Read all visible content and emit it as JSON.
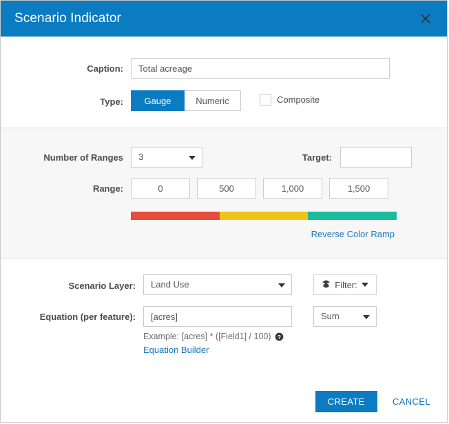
{
  "header": {
    "title": "Scenario Indicator",
    "close_icon": "close-icon"
  },
  "form": {
    "caption": {
      "label": "Caption:",
      "value": "Total acreage"
    },
    "type": {
      "label": "Type:",
      "options": [
        "Gauge",
        "Numeric"
      ],
      "selected": "Gauge",
      "composite_label": "Composite",
      "composite_checked": false
    },
    "ranges": {
      "number_label": "Number of Ranges",
      "number_value": "3",
      "target_label": "Target:",
      "target_value": "",
      "range_label": "Range:",
      "range_values": [
        "0",
        "500",
        "1,000",
        "1,500"
      ],
      "reverse_link": "Reverse Color Ramp",
      "ramp_colors": [
        "#e74c3c",
        "#efc317",
        "#1abc9c"
      ]
    },
    "layer": {
      "label": "Scenario Layer:",
      "value": "Land Use",
      "filter_label": "Filter:",
      "filter_icon": "layers-icon"
    },
    "equation": {
      "label": "Equation (per feature):",
      "value": "[acres]",
      "example": "Example: [acres] * ([Field1] / 100)",
      "help_icon": "help-icon",
      "builder_link": "Equation Builder",
      "aggregation_value": "Sum"
    }
  },
  "footer": {
    "create_label": "CREATE",
    "cancel_label": "CANCEL"
  },
  "theme": {
    "accent": "#0b7cc1",
    "link": "#1574b5",
    "panel_bg": "#f7f7f7"
  }
}
